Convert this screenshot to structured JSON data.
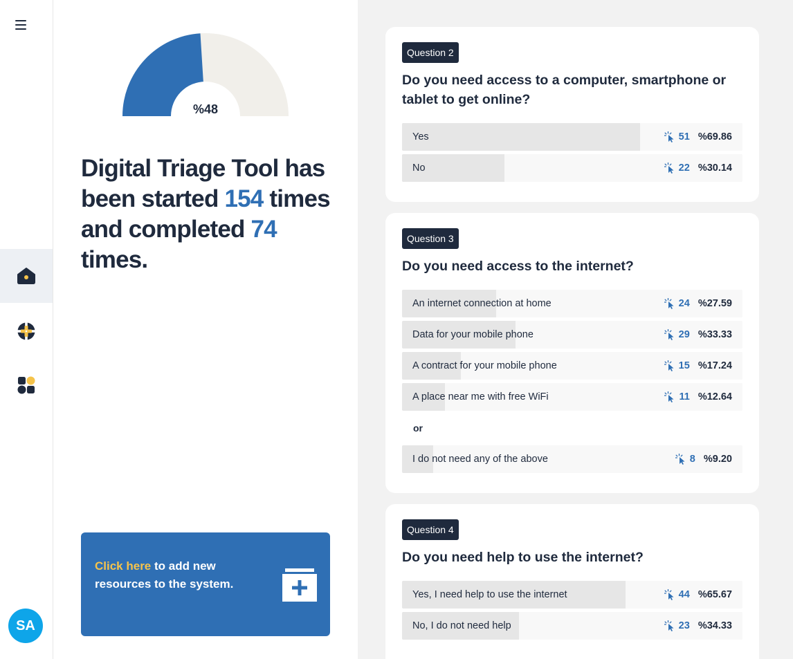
{
  "sidebar": {
    "menu_icon": "hamburger-menu-icon",
    "nav": [
      {
        "icon": "home-icon",
        "active": true
      },
      {
        "icon": "grid-plus-icon",
        "active": false
      },
      {
        "icon": "widgets-icon",
        "active": false
      }
    ],
    "avatar_initials": "SA"
  },
  "stats": {
    "completion_label": "%48",
    "completion_fraction": 0.48,
    "headline_part1": "Digital Triage Tool has been started ",
    "started": "154",
    "headline_part2": " times and completed ",
    "completed": "74",
    "headline_part3": " times."
  },
  "cta": {
    "link_text": "Click here",
    "text": " to add new resources to the system.",
    "icon": "add-resource-icon"
  },
  "colors": {
    "primary": "#2f6fb4",
    "dark": "#1f2a3d",
    "highlight": "#f5c34b",
    "avatar": "#0ea5e9",
    "gauge_track": "#f1efea"
  },
  "questions": [
    {
      "badge": "Question 2",
      "title": "Do you need access to a computer, smartphone or tablet to get online?",
      "options": [
        {
          "label": "Yes",
          "count": "51",
          "percent": "%69.86",
          "fraction": 0.6986
        },
        {
          "label": "No",
          "count": "22",
          "percent": "%30.14",
          "fraction": 0.3014
        }
      ]
    },
    {
      "badge": "Question 3",
      "title": "Do you need access to the internet?",
      "options": [
        {
          "label": "An internet connection at home",
          "count": "24",
          "percent": "%27.59",
          "fraction": 0.2759
        },
        {
          "label": "Data for your mobile phone",
          "count": "29",
          "percent": "%33.33",
          "fraction": 0.3333
        },
        {
          "label": "A contract for your mobile phone",
          "count": "15",
          "percent": "%17.24",
          "fraction": 0.1724
        },
        {
          "label": "A place near me with free WiFi",
          "count": "11",
          "percent": "%12.64",
          "fraction": 0.1264
        },
        {
          "label": "I do not need any of the above",
          "count": "8",
          "percent": "%9.20",
          "fraction": 0.092
        }
      ],
      "or_label": "or"
    },
    {
      "badge": "Question 4",
      "title": "Do you need help to use the internet?",
      "options": [
        {
          "label": "Yes, I need help to use the internet",
          "count": "44",
          "percent": "%65.67",
          "fraction": 0.6567
        },
        {
          "label": "No, I do not need help",
          "count": "23",
          "percent": "%34.33",
          "fraction": 0.3433
        }
      ]
    }
  ]
}
